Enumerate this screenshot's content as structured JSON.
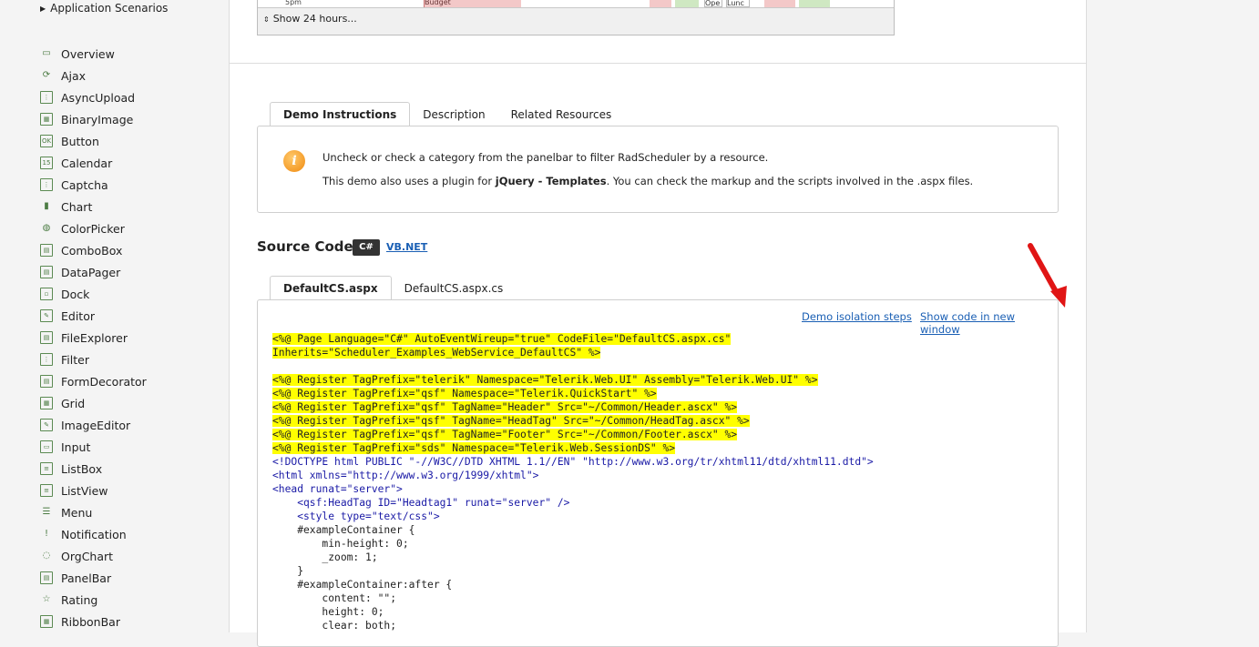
{
  "sidebar": {
    "section": "Application Scenarios",
    "items": [
      {
        "label": "Overview",
        "icon": "overview-icon",
        "glyph": "▭"
      },
      {
        "label": "Ajax",
        "icon": "ajax-icon",
        "glyph": "⟳"
      },
      {
        "label": "AsyncUpload",
        "icon": "asyncupload-icon",
        "glyph": "⋮"
      },
      {
        "label": "BinaryImage",
        "icon": "binaryimage-icon",
        "glyph": "▦"
      },
      {
        "label": "Button",
        "icon": "button-icon",
        "glyph": "OK"
      },
      {
        "label": "Calendar",
        "icon": "calendar-icon",
        "glyph": "15"
      },
      {
        "label": "Captcha",
        "icon": "captcha-icon",
        "glyph": "⋮"
      },
      {
        "label": "Chart",
        "icon": "chart-icon",
        "glyph": "▮"
      },
      {
        "label": "ColorPicker",
        "icon": "colorpicker-icon",
        "glyph": "◍"
      },
      {
        "label": "ComboBox",
        "icon": "combobox-icon",
        "glyph": "▤"
      },
      {
        "label": "DataPager",
        "icon": "datapager-icon",
        "glyph": "▤"
      },
      {
        "label": "Dock",
        "icon": "dock-icon",
        "glyph": "▫"
      },
      {
        "label": "Editor",
        "icon": "editor-icon",
        "glyph": "✎"
      },
      {
        "label": "FileExplorer",
        "icon": "fileexplorer-icon",
        "glyph": "▤"
      },
      {
        "label": "Filter",
        "icon": "filter-icon",
        "glyph": "⋮"
      },
      {
        "label": "FormDecorator",
        "icon": "formdecorator-icon",
        "glyph": "▤"
      },
      {
        "label": "Grid",
        "icon": "grid-icon",
        "glyph": "▦"
      },
      {
        "label": "ImageEditor",
        "icon": "imageeditor-icon",
        "glyph": "✎"
      },
      {
        "label": "Input",
        "icon": "input-icon",
        "glyph": "▭"
      },
      {
        "label": "ListBox",
        "icon": "listbox-icon",
        "glyph": "≡"
      },
      {
        "label": "ListView",
        "icon": "listview-icon",
        "glyph": "≡"
      },
      {
        "label": "Menu",
        "icon": "menu-icon",
        "glyph": "☰"
      },
      {
        "label": "Notification",
        "icon": "notification-icon",
        "glyph": "!"
      },
      {
        "label": "OrgChart",
        "icon": "orgchart-icon",
        "glyph": "◌"
      },
      {
        "label": "PanelBar",
        "icon": "panelbar-icon",
        "glyph": "▤"
      },
      {
        "label": "Rating",
        "icon": "rating-icon",
        "glyph": "☆"
      },
      {
        "label": "RibbonBar",
        "icon": "ribbonbar-icon",
        "glyph": "▦"
      }
    ]
  },
  "scheduler": {
    "hour_label": "5pm",
    "appointment_1": "Budget",
    "appointment_2": "Ope",
    "appointment_3": "Lunc",
    "show_hours": "Show 24 hours..."
  },
  "instructions": {
    "tabs": [
      "Demo Instructions",
      "Description",
      "Related Resources"
    ],
    "line1": "Uncheck or check a category from the panelbar to filter RadScheduler by a resource.",
    "line2_prefix": "This demo also uses a plugin for ",
    "line2_bold": "jQuery - Templates",
    "line2_suffix": ". You can check the markup and the scripts involved in the .aspx files."
  },
  "source_code": {
    "title": "Source Code",
    "cs_label": "C#",
    "vb_label": "VB.NET",
    "file_tabs": [
      "DefaultCS.aspx",
      "DefaultCS.aspx.cs"
    ],
    "isolation_link": "Demo isolation steps",
    "new_window_link": "Show code in new window",
    "lines": [
      "<%@ Page Language=\"C#\" AutoEventWireup=\"true\" CodeFile=\"DefaultCS.aspx.cs\"",
      "Inherits=\"Scheduler_Examples_WebService_DefaultCS\" %>",
      "",
      "<%@ Register TagPrefix=\"telerik\" Namespace=\"Telerik.Web.UI\" Assembly=\"Telerik.Web.UI\" %>",
      "<%@ Register TagPrefix=\"qsf\" Namespace=\"Telerik.QuickStart\" %>",
      "<%@ Register TagPrefix=\"qsf\" TagName=\"Header\" Src=\"~/Common/Header.ascx\" %>",
      "<%@ Register TagPrefix=\"qsf\" TagName=\"HeadTag\" Src=\"~/Common/HeadTag.ascx\" %>",
      "<%@ Register TagPrefix=\"qsf\" TagName=\"Footer\" Src=\"~/Common/Footer.ascx\" %>",
      "<%@ Register TagPrefix=\"sds\" Namespace=\"Telerik.Web.SessionDS\" %>",
      "<!DOCTYPE html PUBLIC \"-//W3C//DTD XHTML 1.1//EN\" \"http://www.w3.org/tr/xhtml11/dtd/xhtml11.dtd\">",
      "<html xmlns=\"http://www.w3.org/1999/xhtml\">",
      "<head runat=\"server\">",
      "    <qsf:HeadTag ID=\"Headtag1\" runat=\"server\" />",
      "    <style type=\"text/css\">",
      "    #exampleContainer {",
      "        min-height: 0;",
      "        _zoom: 1;",
      "    }",
      "    #exampleContainer:after {",
      "        content: \"\";",
      "        height: 0;",
      "        clear: both;"
    ],
    "highlighted_lines": [
      0,
      1,
      3,
      4,
      5,
      6,
      7,
      8
    ],
    "tag_lines": [
      9,
      10,
      11,
      12,
      13
    ]
  },
  "colors": {
    "highlight": "#ffff00",
    "link": "#1a5fb4",
    "arrow": "#e01515",
    "icon_green": "#5b8a52"
  }
}
